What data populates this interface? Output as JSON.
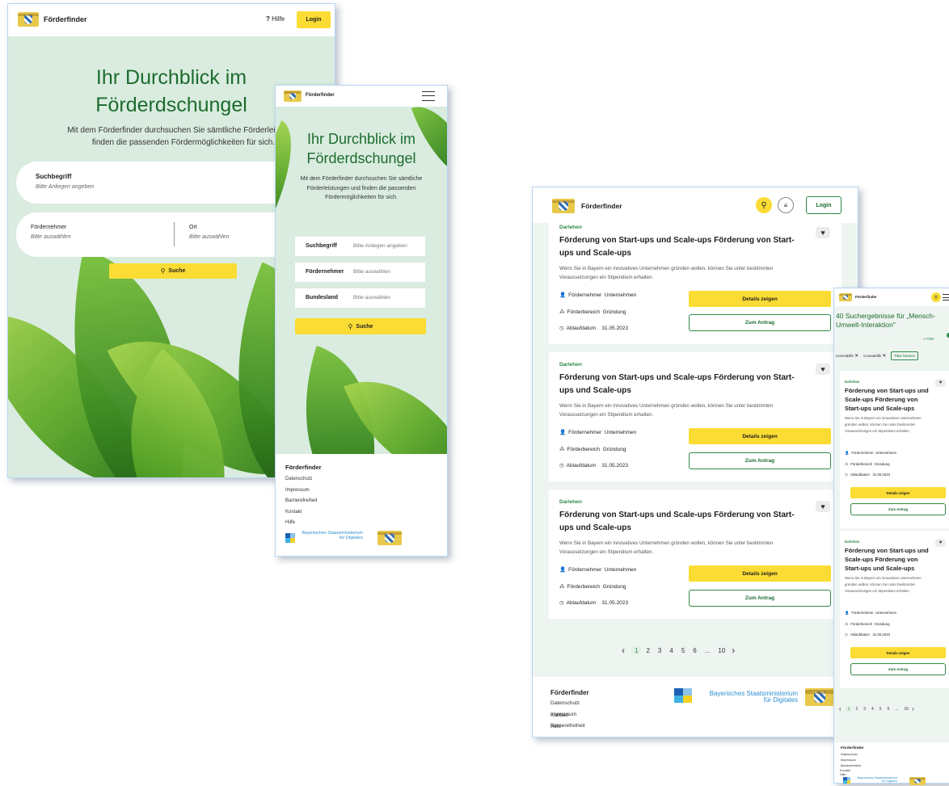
{
  "brand": "Förderfinder",
  "header": {
    "help": "Hilfe",
    "help_icon": "?",
    "login": "Login",
    "search_icon": "search-icon",
    "filter_icon": "filter-icon",
    "menu_icon": "menu-icon"
  },
  "hero": {
    "title_l1": "Ihr Durchblick im",
    "title_l2": "Förderdschungel",
    "desc": "Mit dem Förderfinder durchsuchen Sie sämtliche Förderleistungen und finden die passenden Fördermöglichkeiten für sich.",
    "desc_l1": "Mit dem Förderfinder durchsuchen Sie sämtliche Förderleistunge",
    "desc_l2": "finden die passenden Fördermöglichkeiten für sich."
  },
  "search": {
    "term_label": "Suchbegriff",
    "term_placeholder": "Bitte Anliegen angeben",
    "recipient_label": "Fördernehmer",
    "recipient_placeholder": "Bitte auswählen",
    "place_label": "Ort",
    "place_placeholder": "Bitte auswählen",
    "state_label": "Bundesland",
    "state_placeholder": "Bitte auswählen",
    "button": "Suche"
  },
  "results": {
    "heading": "40 Suchergebnisse für „Mensch-Umwelt-Interaktion\"",
    "filter": "Filter",
    "filter_badge": "",
    "chips": [
      "Coronahilfe",
      "Coronahilfe"
    ],
    "clear_filters": "Filter löschen"
  },
  "card": {
    "category": "Darlehen",
    "title": "Förderung von Start-ups und Scale-ups Förderung von Start-ups und Scale-ups",
    "desc": "Wenn Sie in Bayern ein innovatives Unternehmen gründen wollen, können Sie unter bestimmten Voraussetzungen ein Stipendium erhalten.",
    "recipient_label": "Fördernehmer",
    "recipient_value": "Unternehmen",
    "area_label": "Förderbereich",
    "area_value": "Gründung",
    "expiry_label": "Ablaufdatum",
    "expiry_value": "31.05.2023",
    "details": "Details zeigen",
    "apply": "Zum Antrag"
  },
  "pagination": [
    "1",
    "2",
    "3",
    "4",
    "5",
    "6",
    "...",
    "10"
  ],
  "footer": {
    "title": "Förderfinder",
    "links": [
      "Datenschutz",
      "Impressum",
      "Barrierefreiheit",
      "Kontakt",
      "Hilfe"
    ],
    "ministry_l1": "Bayerisches Staatsministerium",
    "ministry_l2": "für Digitales"
  }
}
